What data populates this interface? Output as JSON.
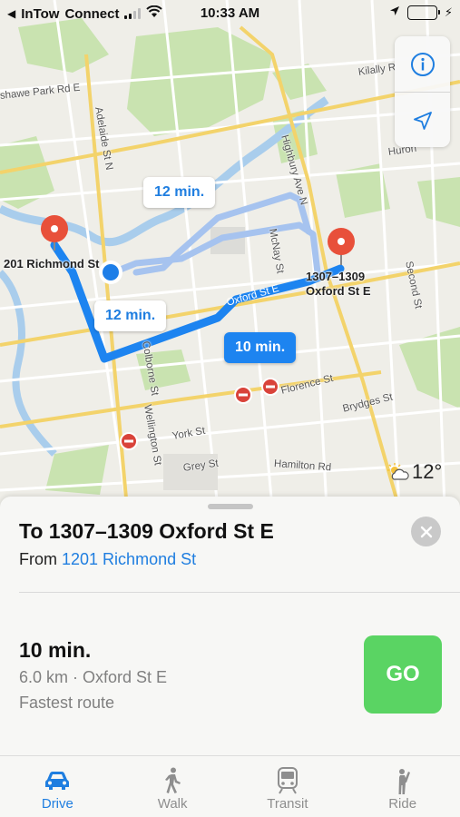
{
  "status_bar": {
    "carrier": "InTow",
    "network": "Connect",
    "time": "10:33 AM"
  },
  "map": {
    "callouts": [
      {
        "label": "12 min."
      },
      {
        "label": "12 min."
      },
      {
        "label": "10 min."
      }
    ],
    "origin_label": "201 Richmond St",
    "destination_label_line1": "1307–1309",
    "destination_label_line2": "Oxford St E",
    "streets": {
      "oshawe_park": "shawe Park Rd E",
      "adelaide": "Adelaide St N",
      "highbury": "Highbury Ave N",
      "mcnay": "McNay St",
      "kilally": "Kilally R",
      "huron": "Huron",
      "second": "Second St",
      "oxford": "Oxford St E",
      "colborne": "Colborne St",
      "wellington": "Wellington St",
      "florence": "Florence St",
      "brydges": "Brydges St",
      "york": "York St",
      "grey": "Grey St",
      "hamilton": "Hamilton Rd"
    },
    "weather": {
      "temperature": "12°",
      "icon": "partly-cloudy-icon"
    }
  },
  "card": {
    "title": "To 1307–1309 Oxford St E",
    "from_prefix": "From",
    "from_link": "1201 Richmond St",
    "route_time": "10 min.",
    "route_meta": "6.0 km · Oxford St E",
    "route_note": "Fastest route",
    "go_label": "GO"
  },
  "tabs": [
    {
      "label": "Drive",
      "icon": "car-icon",
      "active": true
    },
    {
      "label": "Walk",
      "icon": "walker-icon",
      "active": false
    },
    {
      "label": "Transit",
      "icon": "train-icon",
      "active": false
    },
    {
      "label": "Ride",
      "icon": "hail-icon",
      "active": false
    }
  ],
  "colors": {
    "accent": "#1f7ee0",
    "go_green": "#5ad463",
    "pin_red": "#e8503a",
    "route_primary": "#1d84f0",
    "route_alt": "#a6c3ef"
  }
}
